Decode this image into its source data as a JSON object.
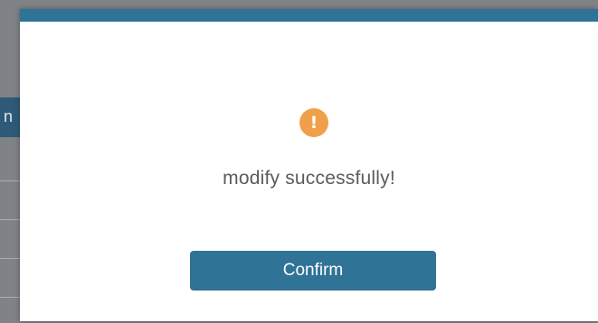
{
  "background": {
    "header_fragment": "n"
  },
  "dialog": {
    "icon": "exclamation-circle-icon",
    "icon_glyph": "!",
    "message": "modify successfully!",
    "confirm_label": "Confirm",
    "colors": {
      "accent": "#2f7396",
      "warning": "#f0a04b",
      "text": "#5b5b5b"
    }
  }
}
